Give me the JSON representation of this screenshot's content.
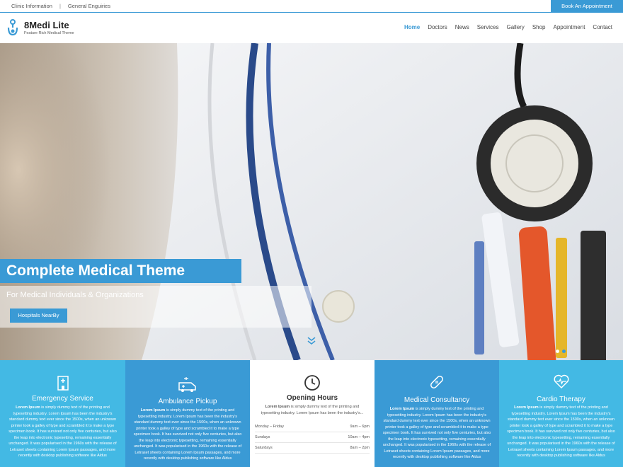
{
  "topbar": {
    "links": [
      "Clinic Information",
      "General Enguiries"
    ],
    "separator": "|",
    "book_button": "Book An Appointment"
  },
  "header": {
    "brand": "8Medi Lite",
    "tagline": "Feature Rich Medical Theme",
    "nav": [
      "Home",
      "Doctors",
      "News",
      "Services",
      "Gallery",
      "Shop",
      "Appointment",
      "Contact"
    ],
    "active_nav": "Home"
  },
  "hero": {
    "title": "Complete Medical Theme",
    "subtitle": "For Medical Individuals & Organizations",
    "button": "Hospitals NearBy"
  },
  "features": [
    {
      "icon": "hospital-icon",
      "title": "Emergency Service",
      "lead": "Lorem Ipsum",
      "text": " is simply dummy text of the printing and typesetting industry. Lorem Ipsum has been the industry's standard dummy text ever since the 1500s, when an unknown printer took a galley of type and scrambled it to make a type specimen book. It has survived not only five centuries, but also the leap into electronic typesetting, remaining essentially unchanged. It was popularised in the 1960s with the release of Letraset sheets containing Lorem Ipsum passages, and more recently with desktop publishing software like Aldus"
    },
    {
      "icon": "ambulance-icon",
      "title": "Ambulance Pickup",
      "lead": "Lorem Ipsum",
      "text": " is simply dummy text of the printing and typesetting industry. Lorem Ipsum has been the industry's standard dummy text ever since the 1500s, when an unknown printer took a galley of type and scrambled it to make a type specimen book. It has survived not only five centuries, but also the leap into electronic typesetting, remaining essentially unchanged. It was popularised in the 1960s with the release of Letraset sheets containing Lorem Ipsum passages, and more recently with desktop publishing software like Aldus"
    },
    {
      "icon": "clock-icon",
      "title": "Opening Hours",
      "lead": "Lorem Ipsum",
      "text": " is simply dummy text of the printing and typesetting industry. Lorem Ipsum has been the industry's...",
      "hours": [
        {
          "day": "Monday – Friday",
          "time": "9am – 6pm"
        },
        {
          "day": "Sundays",
          "time": "10am – 4pm"
        },
        {
          "day": "Saturdays",
          "time": "8am – 2pm"
        }
      ]
    },
    {
      "icon": "bandage-icon",
      "title": "Medical Consultancy",
      "lead": "Lorem Ipsum",
      "text": " is simply dummy text of the printing and typesetting industry. Lorem Ipsum has been the industry's standard dummy text ever since the 1500s, when an unknown printer took a galley of type and scrambled it to make a type specimen book. It has survived not only five centuries, but also the leap into electronic typesetting, remaining essentially unchanged. It was popularised in the 1960s with the release of Letraset sheets containing Lorem Ipsum passages, and more recently with desktop publishing software like Aldus"
    },
    {
      "icon": "heart-pulse-icon",
      "title": "Cardio Therapy",
      "lead": "Lorem Ipsum",
      "text": " is simply dummy text of the printing and typesetting industry. Lorem Ipsum has been the industry's standard dummy text ever since the 1500s, when an unknown printer took a galley of type and scrambled it to make a type specimen book. It has survived not only five centuries, but also the leap into electronic typesetting, remaining essentially unchanged. It was popularised in the 1960s with the release of Letraset sheets containing Lorem Ipsum passages, and more recently with desktop publishing software like Aldus"
    }
  ],
  "colors": {
    "primary": "#3a9ad5",
    "light": "#43b9e4"
  }
}
